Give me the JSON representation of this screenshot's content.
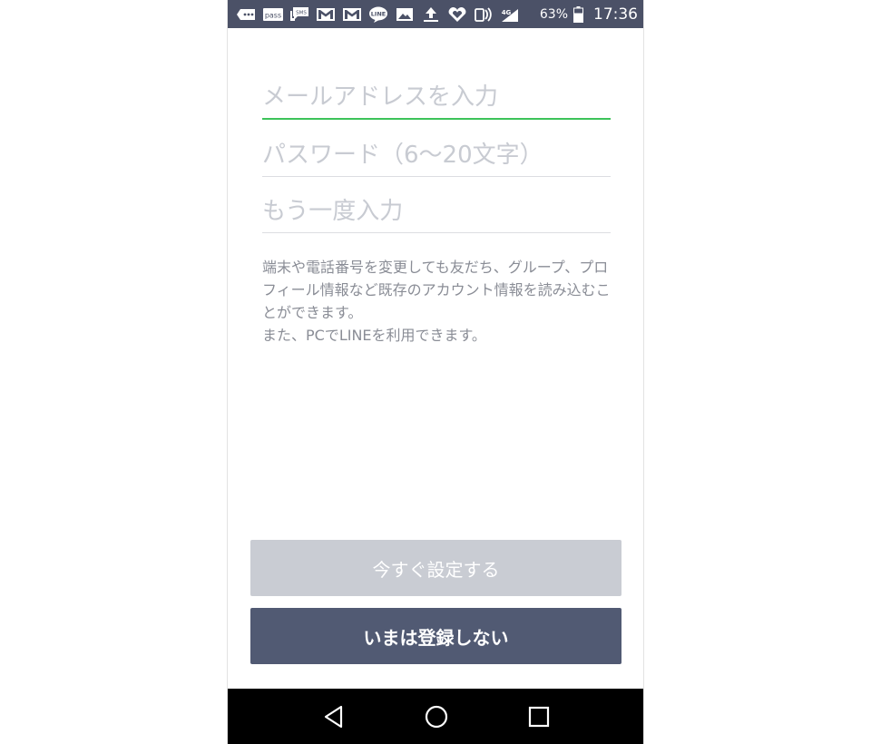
{
  "status_bar": {
    "icons": [
      "more-notifications-icon",
      "pass-app-icon",
      "sms-icon",
      "gmail-icon",
      "gmail-icon",
      "line-icon",
      "image-icon",
      "upload-icon",
      "heart-app-icon",
      "nfc-icon",
      "signal-4g-icon"
    ],
    "pass_label": "pass",
    "sms_label": "SMS",
    "line_label": "LINE",
    "network_label": "4G",
    "battery_percent": "63%",
    "time": "17:36"
  },
  "form": {
    "email_placeholder": "メールアドレスを入力",
    "email_value": "",
    "password_placeholder": "パスワード（6〜20文字）",
    "password_value": "",
    "confirm_placeholder": "もう一度入力",
    "confirm_value": "",
    "description": "端末や電話番号を変更しても友だち、グループ、プロフィール情報など既存のアカウント情報を読み込むことができます。\nまた、PCでLINEを利用できます。"
  },
  "buttons": {
    "set_now": "今すぐ設定する",
    "skip": "いまは登録しない"
  },
  "nav": {
    "icons": [
      "back-icon",
      "home-icon",
      "recents-icon"
    ]
  },
  "colors": {
    "status_bar": "#4b5167",
    "active_underline": "#3dc35a",
    "primary_button_disabled": "#c9ccd3",
    "secondary_button": "#515a73"
  }
}
